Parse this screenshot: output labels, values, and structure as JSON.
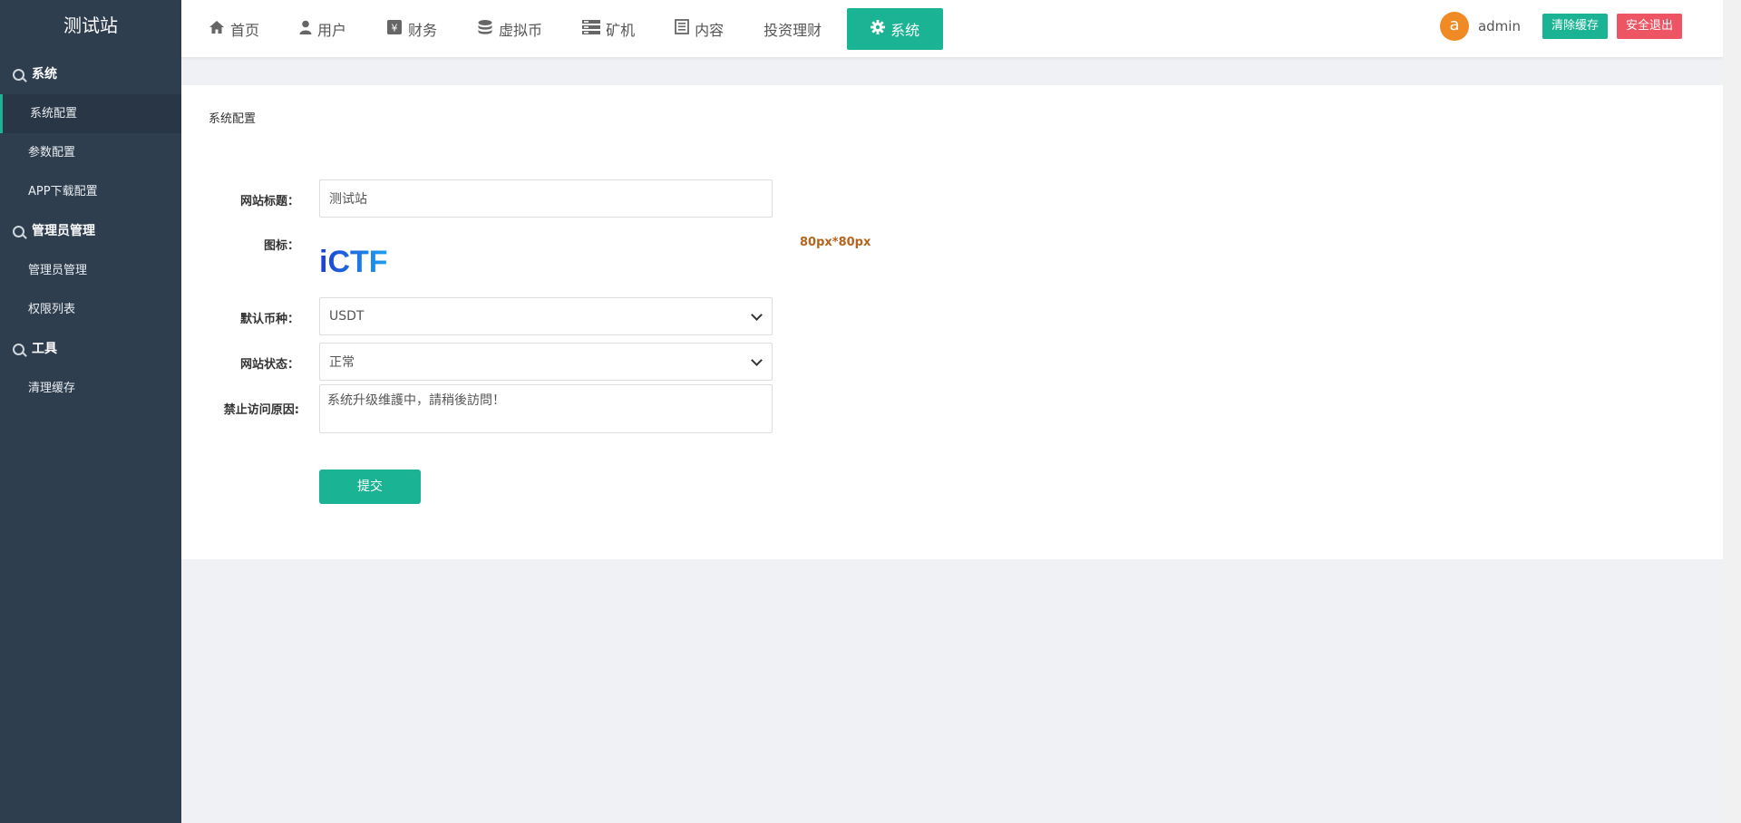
{
  "brand": "测试站",
  "sidebar": {
    "groups": [
      {
        "title": "系统",
        "items": [
          {
            "label": "系统配置"
          },
          {
            "label": "参数配置"
          },
          {
            "label": "APP下载配置"
          }
        ]
      },
      {
        "title": "管理员管理",
        "items": [
          {
            "label": "管理员管理"
          },
          {
            "label": "权限列表"
          }
        ]
      },
      {
        "title": "工具",
        "items": [
          {
            "label": "清理缓存"
          }
        ]
      }
    ]
  },
  "nav": {
    "items": [
      {
        "label": "首页",
        "icon": "home-icon"
      },
      {
        "label": "用户",
        "icon": "user-icon"
      },
      {
        "label": "财务",
        "icon": "finance-icon"
      },
      {
        "label": "虚拟币",
        "icon": "database-icon"
      },
      {
        "label": "矿机",
        "icon": "server-icon"
      },
      {
        "label": "内容",
        "icon": "document-icon"
      },
      {
        "label": "投资理财",
        "icon": ""
      },
      {
        "label": "系统",
        "icon": "gear-icon"
      }
    ]
  },
  "user": {
    "avatar_letter": "a",
    "name": "admin"
  },
  "toolbar": {
    "clear_cache": "清除缓存",
    "logout": "安全退出"
  },
  "form": {
    "title": "系统配置",
    "site_title_label": "网站标题：",
    "site_title_value": "测试站",
    "icon_label": "图标：",
    "icon_logo_text": "iCTF",
    "icon_hint": "80px*80px",
    "currency_label": "默认币种：",
    "currency_value": "USDT",
    "status_label": "网站状态：",
    "status_value": "正常",
    "reason_label": "禁止访问原因:",
    "reason_value": "系统升级维護中，請稍後訪問！",
    "submit_label": "提交"
  },
  "colors": {
    "accent": "#1ab394",
    "danger": "#ed5565",
    "sidebar": "#2f3e4f",
    "avatar": "#f08a24",
    "hint": "#b5651d"
  }
}
